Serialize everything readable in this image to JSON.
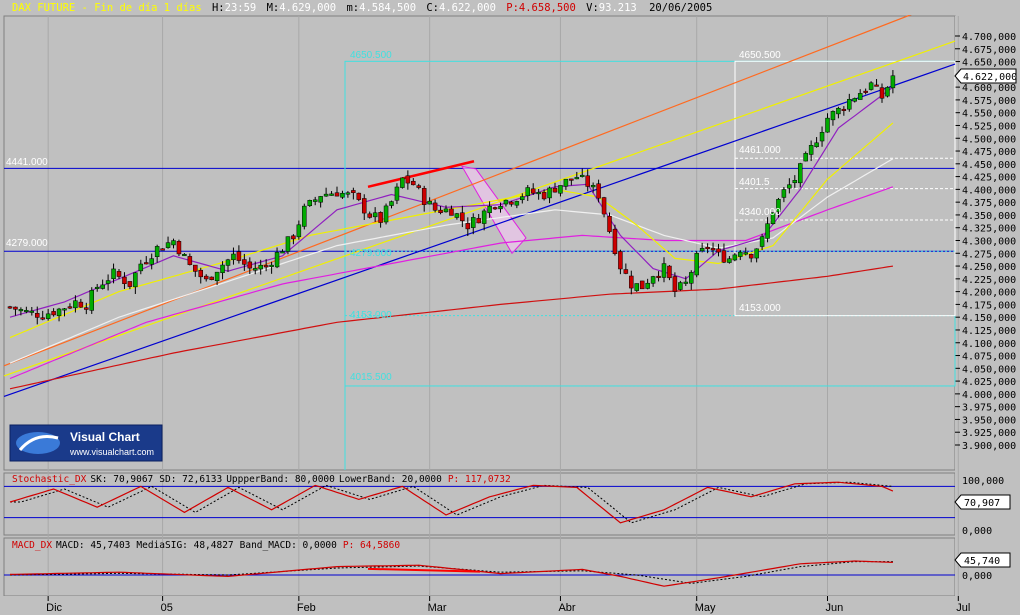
{
  "header": {
    "symbol": "DAX FUTURE",
    "period": "Fin de día 1 días",
    "time_label": "H:",
    "time": "23:59",
    "max_label": "M:",
    "max": "4.629,000",
    "min_label": "m:",
    "min": "4.584,500",
    "close_label": "C:",
    "close": "4.622,000",
    "price_label": "P:",
    "price": "4.658,500",
    "vol_label": "V:",
    "vol": "93.213",
    "date": "20/06/2005"
  },
  "logo": {
    "title": "Visual Chart",
    "url": "www.visualchart.com"
  },
  "levels": {
    "h1": "4441.000",
    "h2": "4279.000",
    "box1": [
      "4650.500",
      "4279.000",
      "4153.000",
      "4015.500"
    ],
    "box2": [
      "4650.500",
      "4461.000",
      "4401.5",
      "4340.000",
      "4153.000"
    ]
  },
  "price_badge": "4.622,000",
  "stoch_badge": "70,907",
  "macd_badge": "45,740",
  "stoch_title": {
    "name": "Stochastic_DX",
    "sk": "SK: 70,9067",
    "sd": "SD: 72,6133",
    "ub": "UppperBand: 80,0000",
    "lb": "LowerBand: 20,0000",
    "p": "P: 117,0732"
  },
  "macd_title": {
    "name": "MACD_DX",
    "macd": "MACD: 45,7403",
    "sig": "MediaSIG: 48,4827",
    "band": "Band_MACD: 0,0000",
    "p": "P: 64,5860"
  },
  "stoch_axis": [
    "100,000",
    "0,000"
  ],
  "macd_axis": [
    "0,000"
  ],
  "colors": {
    "bg": "#c0c0c0",
    "grid": "#a8a8a8",
    "bull": "#00aa00",
    "bear": "#cc0000",
    "ma_red": "#d01010",
    "ma_mag": "#e020e0",
    "ma_white": "#f0f0f0",
    "ma_yellow": "#f0f000",
    "trend_blue": "#0000d0",
    "trend_orange": "#ff6a20",
    "cyan": "#40e0e0"
  },
  "chart_data": {
    "type": "candlestick",
    "y_ticks": [
      "4.700,000",
      "4.675,000",
      "4.650,000",
      "4.625,000",
      "4.600,000",
      "4.575,000",
      "4.550,000",
      "4.525,000",
      "4.500,000",
      "4.475,000",
      "4.450,000",
      "4.425,000",
      "4.400,000",
      "4.375,000",
      "4.350,000",
      "4.325,000",
      "4.300,000",
      "4.275,000",
      "4.250,000",
      "4.225,000",
      "4.200,000",
      "4.175,000",
      "4.150,000",
      "4.125,000",
      "4.100,000",
      "4.075,000",
      "4.050,000",
      "4.025,000",
      "4.000,000",
      "3.975,000",
      "3.950,000",
      "3.925,000",
      "3.900,000"
    ],
    "ylim": [
      3870,
      4725
    ],
    "x_labels": [
      "Dic",
      "05",
      "Feb",
      "Mar",
      "Abr",
      "May",
      "Jun",
      "Jul"
    ],
    "x_label_bars": [
      7,
      28,
      53,
      77,
      101,
      126,
      150,
      174
    ],
    "bars": 174,
    "anchors": [
      [
        0,
        4170
      ],
      [
        3,
        4160
      ],
      [
        6,
        4155
      ],
      [
        9,
        4165
      ],
      [
        12,
        4180
      ],
      [
        14,
        4175
      ],
      [
        16,
        4210
      ],
      [
        19,
        4235
      ],
      [
        22,
        4215
      ],
      [
        24,
        4255
      ],
      [
        27,
        4285
      ],
      [
        30,
        4300
      ],
      [
        33,
        4250
      ],
      [
        36,
        4220
      ],
      [
        38,
        4245
      ],
      [
        41,
        4270
      ],
      [
        44,
        4245
      ],
      [
        47,
        4250
      ],
      [
        50,
        4285
      ],
      [
        52,
        4310
      ],
      [
        54,
        4360
      ],
      [
        57,
        4390
      ],
      [
        60,
        4395
      ],
      [
        63,
        4385
      ],
      [
        66,
        4350
      ],
      [
        68,
        4340
      ],
      [
        70,
        4375
      ],
      [
        72,
        4420
      ],
      [
        74,
        4410
      ],
      [
        76,
        4380
      ],
      [
        78,
        4360
      ],
      [
        81,
        4360
      ],
      [
        84,
        4330
      ],
      [
        86,
        4345
      ],
      [
        89,
        4375
      ],
      [
        92,
        4380
      ],
      [
        95,
        4395
      ],
      [
        98,
        4390
      ],
      [
        101,
        4410
      ],
      [
        104,
        4425
      ],
      [
        106,
        4410
      ],
      [
        108,
        4390
      ],
      [
        110,
        4320
      ],
      [
        112,
        4250
      ],
      [
        114,
        4215
      ],
      [
        116,
        4210
      ],
      [
        118,
        4235
      ],
      [
        120,
        4245
      ],
      [
        122,
        4200
      ],
      [
        124,
        4215
      ],
      [
        126,
        4265
      ],
      [
        128,
        4290
      ],
      [
        130,
        4270
      ],
      [
        132,
        4265
      ],
      [
        134,
        4285
      ],
      [
        136,
        4275
      ],
      [
        138,
        4300
      ],
      [
        140,
        4360
      ],
      [
        142,
        4395
      ],
      [
        144,
        4420
      ],
      [
        146,
        4460
      ],
      [
        148,
        4500
      ],
      [
        150,
        4540
      ],
      [
        152,
        4555
      ],
      [
        154,
        4575
      ],
      [
        156,
        4590
      ],
      [
        158,
        4605
      ],
      [
        160,
        4580
      ],
      [
        162,
        4622
      ]
    ],
    "series": [
      {
        "name": "MA slow",
        "points": [
          [
            0,
            4010
          ],
          [
            30,
            4080
          ],
          [
            60,
            4140
          ],
          [
            90,
            4175
          ],
          [
            110,
            4195
          ],
          [
            130,
            4205
          ],
          [
            150,
            4230
          ],
          [
            162,
            4250
          ]
        ]
      },
      {
        "name": "MA mid",
        "points": [
          [
            0,
            4030
          ],
          [
            25,
            4140
          ],
          [
            50,
            4215
          ],
          [
            70,
            4255
          ],
          [
            90,
            4295
          ],
          [
            105,
            4310
          ],
          [
            120,
            4300
          ],
          [
            135,
            4300
          ],
          [
            150,
            4360
          ],
          [
            162,
            4405
          ]
        ]
      },
      {
        "name": "MA white",
        "points": [
          [
            0,
            4060
          ],
          [
            20,
            4150
          ],
          [
            40,
            4220
          ],
          [
            60,
            4290
          ],
          [
            80,
            4330
          ],
          [
            100,
            4360
          ],
          [
            110,
            4350
          ],
          [
            120,
            4310
          ],
          [
            130,
            4285
          ],
          [
            140,
            4305
          ],
          [
            150,
            4385
          ],
          [
            162,
            4460
          ]
        ]
      },
      {
        "name": "MA yellow",
        "points": [
          [
            0,
            4110
          ],
          [
            20,
            4200
          ],
          [
            40,
            4260
          ],
          [
            55,
            4310
          ],
          [
            70,
            4340
          ],
          [
            85,
            4370
          ],
          [
            100,
            4400
          ],
          [
            108,
            4385
          ],
          [
            115,
            4330
          ],
          [
            122,
            4265
          ],
          [
            130,
            4255
          ],
          [
            140,
            4290
          ],
          [
            150,
            4420
          ],
          [
            162,
            4530
          ]
        ]
      },
      {
        "name": "MA purple",
        "points": [
          [
            0,
            4150
          ],
          [
            10,
            4180
          ],
          [
            20,
            4225
          ],
          [
            30,
            4270
          ],
          [
            40,
            4240
          ],
          [
            50,
            4270
          ],
          [
            60,
            4360
          ],
          [
            70,
            4390
          ],
          [
            80,
            4365
          ],
          [
            90,
            4370
          ],
          [
            100,
            4405
          ],
          [
            106,
            4410
          ],
          [
            112,
            4310
          ],
          [
            118,
            4245
          ],
          [
            124,
            4225
          ],
          [
            130,
            4280
          ],
          [
            138,
            4305
          ],
          [
            145,
            4400
          ],
          [
            152,
            4520
          ],
          [
            162,
            4600
          ]
        ]
      }
    ],
    "stochastic": {
      "sk": [
        [
          0,
          50
        ],
        [
          8,
          75
        ],
        [
          16,
          40
        ],
        [
          24,
          80
        ],
        [
          32,
          30
        ],
        [
          40,
          78
        ],
        [
          48,
          35
        ],
        [
          56,
          82
        ],
        [
          64,
          55
        ],
        [
          72,
          80
        ],
        [
          80,
          25
        ],
        [
          88,
          60
        ],
        [
          96,
          82
        ],
        [
          104,
          78
        ],
        [
          112,
          10
        ],
        [
          120,
          35
        ],
        [
          128,
          78
        ],
        [
          136,
          60
        ],
        [
          144,
          85
        ],
        [
          152,
          88
        ],
        [
          160,
          80
        ],
        [
          162,
          71
        ]
      ],
      "upper": 80,
      "lower": 20
    },
    "macd": {
      "macd": [
        [
          0,
          2
        ],
        [
          20,
          10
        ],
        [
          40,
          -5
        ],
        [
          60,
          30
        ],
        [
          75,
          35
        ],
        [
          90,
          5
        ],
        [
          105,
          20
        ],
        [
          112,
          -5
        ],
        [
          120,
          -40
        ],
        [
          130,
          -10
        ],
        [
          145,
          40
        ],
        [
          155,
          50
        ],
        [
          162,
          45
        ]
      ],
      "sig": [
        [
          0,
          0
        ],
        [
          20,
          6
        ],
        [
          40,
          0
        ],
        [
          60,
          25
        ],
        [
          75,
          32
        ],
        [
          90,
          10
        ],
        [
          105,
          15
        ],
        [
          115,
          0
        ],
        [
          125,
          -30
        ],
        [
          135,
          -5
        ],
        [
          145,
          30
        ],
        [
          155,
          48
        ],
        [
          162,
          48
        ]
      ]
    }
  }
}
